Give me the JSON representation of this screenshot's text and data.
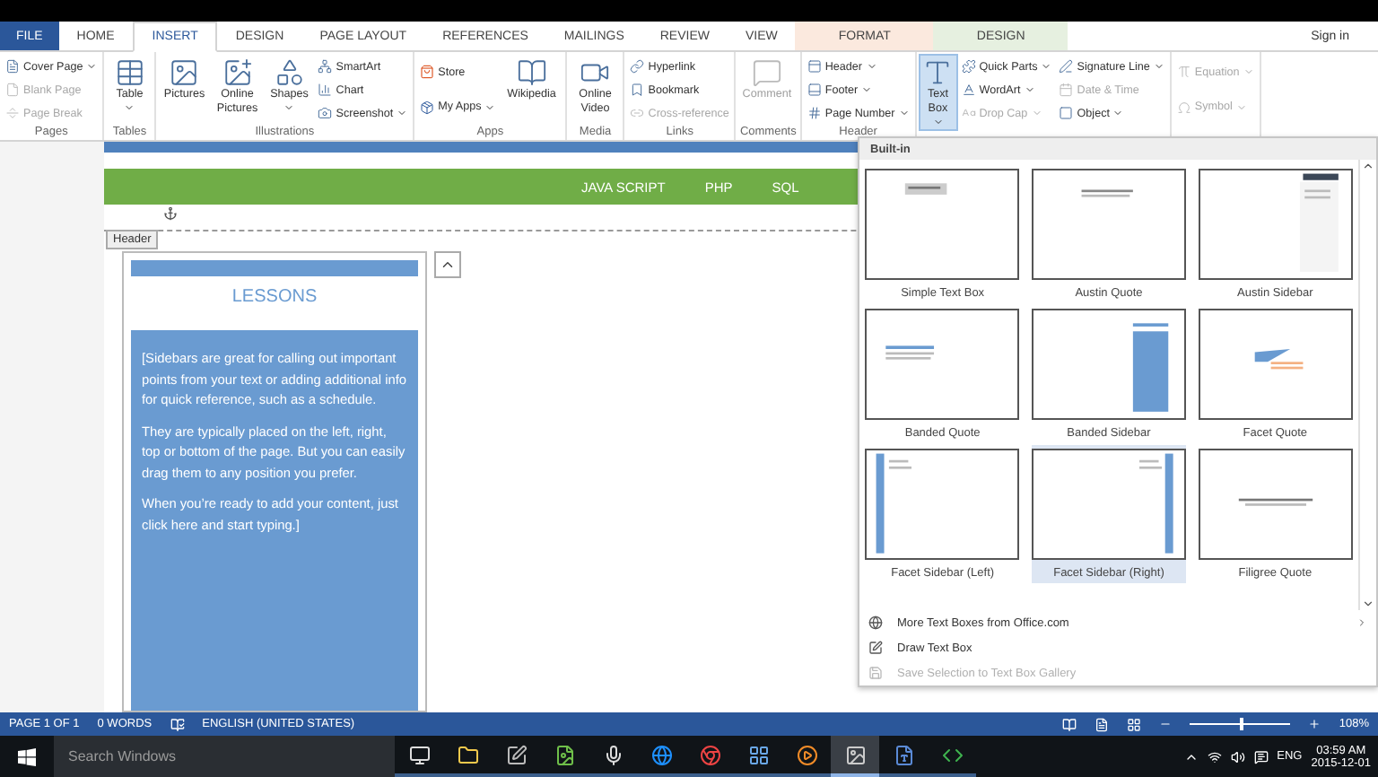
{
  "tabs": [
    {
      "label": "FILE",
      "kind": "file",
      "selected": false
    },
    {
      "label": "HOME",
      "kind": "tab",
      "selected": false
    },
    {
      "label": "INSERT",
      "kind": "tab",
      "selected": true
    },
    {
      "label": "DESIGN",
      "kind": "tab",
      "selected": false
    },
    {
      "label": "PAGE LAYOUT",
      "kind": "tab",
      "selected": false
    },
    {
      "label": "REFERENCES",
      "kind": "tab",
      "selected": false
    },
    {
      "label": "MAILINGS",
      "kind": "tab",
      "selected": false
    },
    {
      "label": "REVIEW",
      "kind": "tab",
      "selected": false
    },
    {
      "label": "VIEW",
      "kind": "tab",
      "selected": false
    },
    {
      "label": "FORMAT",
      "kind": "context",
      "selected": false,
      "color": "#fbe9de"
    },
    {
      "label": "DESIGN",
      "kind": "context",
      "selected": false,
      "color": "#e6f0e0"
    }
  ],
  "sign_in": "Sign in",
  "ribbon": [
    {
      "label": "Pages",
      "columns": [
        {
          "kind": "stack",
          "items": [
            {
              "label": "Cover Page",
              "dropdown": true,
              "disabled": false
            },
            {
              "label": "Blank Page",
              "dropdown": false,
              "disabled": true
            },
            {
              "label": "Page Break",
              "dropdown": false,
              "disabled": true
            }
          ]
        }
      ]
    },
    {
      "label": "Tables",
      "columns": [
        {
          "kind": "large",
          "label": "Table",
          "dropdown": true,
          "disabled": false,
          "pressed": false
        }
      ]
    },
    {
      "label": "Illustrations",
      "columns": [
        {
          "kind": "large",
          "label": "Pictures",
          "dropdown": false,
          "disabled": false,
          "pressed": false
        },
        {
          "kind": "large",
          "label": "Online Pictures",
          "dropdown": false,
          "disabled": false,
          "pressed": false
        },
        {
          "kind": "large",
          "label": "Shapes",
          "dropdown": true,
          "disabled": false,
          "pressed": false
        },
        {
          "kind": "stack",
          "items": [
            {
              "label": "SmartArt",
              "dropdown": false,
              "disabled": false
            },
            {
              "label": "Chart",
              "dropdown": false,
              "disabled": false
            },
            {
              "label": "Screenshot",
              "dropdown": true,
              "disabled": false
            }
          ]
        }
      ]
    },
    {
      "label": "Apps",
      "columns": [
        {
          "kind": "stack",
          "items": [
            {
              "label": "Store",
              "dropdown": false,
              "disabled": false
            },
            {
              "label": "My Apps",
              "dropdown": true,
              "disabled": false
            }
          ]
        },
        {
          "kind": "large",
          "label": "Wikipedia",
          "dropdown": false,
          "disabled": false,
          "pressed": false
        }
      ]
    },
    {
      "label": "Media",
      "columns": [
        {
          "kind": "large",
          "label": "Online Video",
          "dropdown": false,
          "disabled": false,
          "pressed": false
        }
      ]
    },
    {
      "label": "Links",
      "columns": [
        {
          "kind": "stack",
          "items": [
            {
              "label": "Hyperlink",
              "dropdown": false,
              "disabled": false
            },
            {
              "label": "Bookmark",
              "dropdown": false,
              "disabled": false
            },
            {
              "label": "Cross-reference",
              "dropdown": false,
              "disabled": true
            }
          ]
        }
      ]
    },
    {
      "label": "Comments",
      "columns": [
        {
          "kind": "large",
          "label": "Comment",
          "dropdown": false,
          "disabled": true,
          "pressed": false
        }
      ]
    },
    {
      "label": "Header",
      "columns": [
        {
          "kind": "stack",
          "items": [
            {
              "label": "Header",
              "dropdown": true,
              "disabled": false
            },
            {
              "label": "Footer",
              "dropdown": true,
              "disabled": false
            },
            {
              "label": "Page Number",
              "dropdown": true,
              "disabled": false
            }
          ]
        }
      ]
    },
    {
      "columns": [
        {
          "kind": "large",
          "label": "Text Box",
          "dropdown": true,
          "disabled": false,
          "pressed": true
        },
        {
          "kind": "stack",
          "items": [
            {
              "label": "Quick Parts",
              "dropdown": true,
              "disabled": false
            },
            {
              "label": "WordArt",
              "dropdown": true,
              "disabled": false
            },
            {
              "label": "Drop Cap",
              "dropdown": true,
              "disabled": true
            }
          ]
        },
        {
          "kind": "stack",
          "items": [
            {
              "label": "Signature Line",
              "dropdown": true,
              "disabled": false
            },
            {
              "label": "Date & Time",
              "dropdown": false,
              "disabled": true
            },
            {
              "label": "Object",
              "dropdown": true,
              "disabled": false
            }
          ]
        }
      ]
    },
    {
      "columns": [
        {
          "kind": "stack",
          "items": [
            {
              "label": "Equation",
              "dropdown": true,
              "disabled": true
            },
            {
              "label": "Symbol",
              "dropdown": true,
              "disabled": true
            }
          ]
        }
      ]
    }
  ],
  "document": {
    "nav_items": [
      "JAVA SCRIPT",
      "PHP",
      "SQL"
    ],
    "header_tag": "Header",
    "sidebar": {
      "title": "LESSONS",
      "paragraphs": [
        "[Sidebars are great for calling out important points from your text or adding additional info for quick reference, such as a schedule.",
        "They are typically placed on the left, right, top or bottom of the page. But you can easily drag them to any position you prefer.",
        "When you’re ready to add your content, just click here and start typing.]"
      ]
    }
  },
  "text_box_menu": {
    "section": "Built-in",
    "gallery": [
      {
        "label": "Simple Text Box",
        "kind": "simple",
        "selected": false
      },
      {
        "label": "Austin Quote",
        "kind": "centered",
        "selected": false
      },
      {
        "label": "Austin Sidebar",
        "kind": "rightbar",
        "selected": false
      },
      {
        "label": "Banded Quote",
        "kind": "banded",
        "selected": false
      },
      {
        "label": "Banded Sidebar",
        "kind": "bandedbar",
        "selected": false
      },
      {
        "label": "Facet Quote",
        "kind": "facet",
        "selected": false
      },
      {
        "label": "Facet Sidebar (Left)",
        "kind": "leftstripe",
        "selected": false
      },
      {
        "label": "Facet Sidebar (Right)",
        "kind": "rightstripe",
        "selected": true
      },
      {
        "label": "Filigree Quote",
        "kind": "filigree",
        "selected": false
      }
    ],
    "commands": [
      {
        "label": "More Text Boxes from Office.com",
        "submenu": true,
        "disabled": false
      },
      {
        "label": "Draw Text Box",
        "submenu": false,
        "disabled": false
      },
      {
        "label": "Save Selection to Text Box Gallery",
        "submenu": false,
        "disabled": true
      }
    ]
  },
  "status_bar": {
    "page": "PAGE 1 OF 1",
    "words": "0 WORDS",
    "language": "ENGLISH (UNITED STATES)",
    "zoom": {
      "level": 0.5
    },
    "zoom_reading": "108%"
  },
  "taskbar": {
    "search": {
      "placeholder": "Search Windows"
    },
    "apps": [
      {
        "selected": false
      },
      {
        "selected": false
      },
      {
        "selected": false
      },
      {
        "selected": false
      },
      {
        "selected": false
      },
      {
        "selected": false
      },
      {
        "selected": false
      },
      {
        "selected": false
      },
      {
        "selected": false
      },
      {
        "selected": true
      },
      {
        "selected": false
      },
      {
        "selected": false
      }
    ],
    "language": "ENG",
    "time": "03:59 AM",
    "date": "2015-12-01"
  }
}
